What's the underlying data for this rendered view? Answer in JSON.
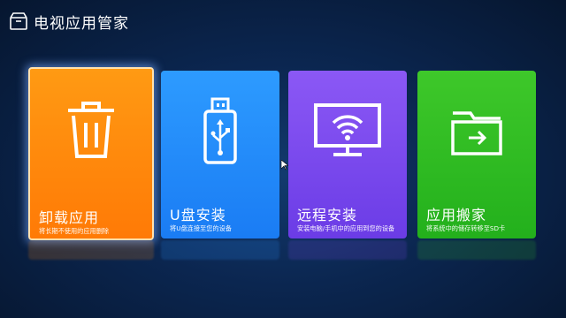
{
  "header": {
    "title": "电视应用管家",
    "icon": "tv-box-icon"
  },
  "tiles": [
    {
      "title": "卸载应用",
      "desc": "将长期不使用的应用删除",
      "icon": "trash-icon",
      "color": "#ff8a10",
      "selected": true
    },
    {
      "title": "U盘安装",
      "desc": "将U盘连接至您的设备",
      "icon": "usb-drive-icon",
      "color": "#2a90ff",
      "selected": false
    },
    {
      "title": "远程安装",
      "desc": "安装电脑/手机中的应用到您的设备",
      "icon": "wifi-monitor-icon",
      "color": "#7a48ee",
      "selected": false
    },
    {
      "title": "应用搬家",
      "desc": "将系统中的储存转移至SD卡",
      "icon": "folder-move-icon",
      "color": "#33be26",
      "selected": false
    }
  ]
}
